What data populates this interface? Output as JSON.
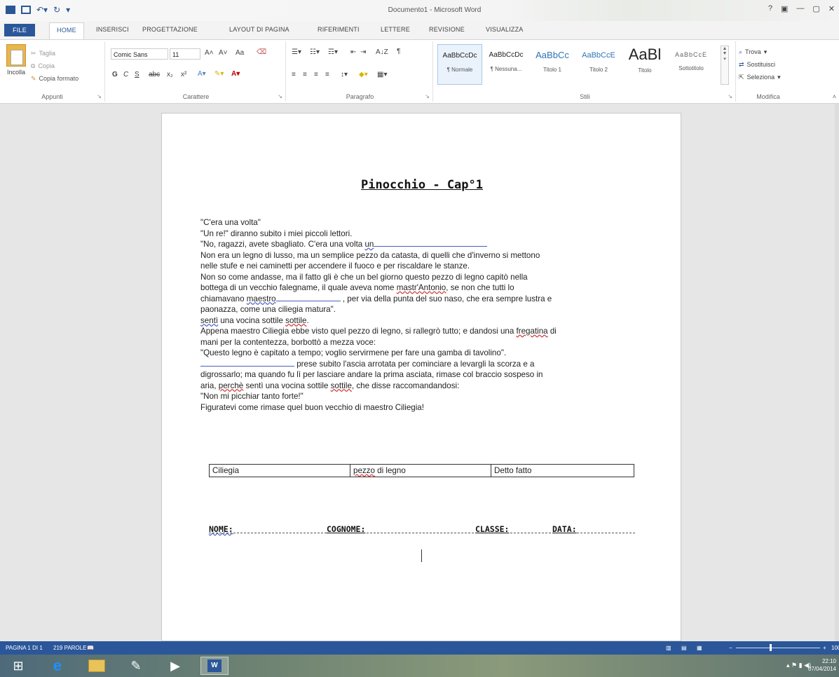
{
  "window": {
    "title": "Documento1 - Microsoft Word",
    "help": "?",
    "controls": [
      "—",
      "▢",
      "✕"
    ]
  },
  "tabs": [
    "FILE",
    "HOME",
    "INSERISCI",
    "PROGETTAZIONE",
    "LAYOUT DI PAGINA",
    "RIFERIMENTI",
    "LETTERE",
    "REVISIONE",
    "VISUALIZZA"
  ],
  "ribbon": {
    "clipboard": {
      "label": "Appunti",
      "paste": "Incolla",
      "cut": "Taglia",
      "copy": "Copia",
      "format_painter": "Copia formato"
    },
    "font": {
      "label": "Carattere",
      "font_name": "Comic Sans",
      "font_size": "11",
      "bold": "G",
      "italic": "C",
      "underline": "S",
      "strike": "abc",
      "subscript": "x₂",
      "superscript": "x²",
      "case": "Aa"
    },
    "paragraph": {
      "label": "Paragrafo",
      "sort": "A↓Z",
      "show_marks": "¶"
    },
    "styles": {
      "label": "Stili",
      "items": [
        {
          "preview": "AaBbCcDc",
          "name": "¶ Normale"
        },
        {
          "preview": "AaBbCcDc",
          "name": "¶ Nessuna..."
        },
        {
          "preview": "AaBbCc",
          "name": "Titolo 1"
        },
        {
          "preview": "AaBbCcE",
          "name": "Titolo 2"
        },
        {
          "preview": "AaBl",
          "name": "Titolo"
        },
        {
          "preview": "AaBbCcE",
          "name": "Sottotitolo"
        }
      ]
    },
    "editing": {
      "label": "Modifica",
      "find": "Trova",
      "replace": "Sostituisci",
      "select": "Seleziona"
    }
  },
  "document": {
    "title": "Pinocchio - Cap°1",
    "lines": {
      "l1": "\"C'era una volta\"",
      "l2": "\"Un re!\" diranno subito i miei piccoli lettori.",
      "l3a": "\"No, ragazzi, avete sbagliato. C'era una volta ",
      "l3b": "un",
      "l4": "Non era un legno di lusso, ma un semplice pezzo da catasta, di quelli che d'inverno si mettono",
      "l5": "nelle stufe e nei caminetti per accendere il fuoco e per riscaldare le stanze.",
      "l6": "Non so come andasse, ma il fatto gli è che un bel giorno questo pezzo di legno capitò nella",
      "l7a": "bottega di un vecchio falegname, il quale aveva nome ",
      "l7b": "mastr'Antonio",
      "l7c": ", se non che tutti lo",
      "l8a": "chiamavano ",
      "l8b": "maestro",
      "l8c": " , per via della punta del suo naso, che era sempre lustra e",
      "l9": "paonazza, come una ciliegia matura\".",
      "l10a": "sentì",
      "l10b": " una vocina sottile ",
      "l10c": "sottile",
      "l10d": ".",
      "l11a": "Appena maestro Ciliegia ebbe visto quel pezzo di legno, si rallegrò tutto; e dandosi una ",
      "l11b": "fregatina",
      "l11c": " di",
      "l12": "mani per la contentezza, borbottò a mezza voce:",
      "l13": "\"Questo legno è capitato a tempo; voglio servirmene per fare una gamba di tavolino\".",
      "l14": " prese subito l'ascia arrotata per cominciare a levargli la scorza e a",
      "l15": "digrossarlo; ma quando fu lì per lasciare andare la prima asciata, rimase col braccio sospeso in",
      "l16a": "aria, ",
      "l16b": "perchè",
      "l16c": " sentì una vocina sottile ",
      "l16d": "sottile",
      "l16e": ", che disse raccomandandosi:",
      "l17": "\"Non mi picchiar tanto forte!\"",
      "l18": "Figuratevi come rimase quel buon vecchio di maestro Ciliegia!"
    },
    "table": {
      "c1": "Ciliegia",
      "c2a": "pezzo",
      "c2b": " di legno",
      "c3": "Detto fatto"
    },
    "sign": {
      "nome": "NOME:",
      "cognome": "COGNOME:",
      "classe": "CLASSE:",
      "data": "DATA:"
    }
  },
  "status": {
    "page": "PAGINA 1 DI 1",
    "words": "219 PAROLE",
    "zoom": "100%"
  },
  "clock": {
    "time": "22:10",
    "date": "07/04/2014"
  }
}
